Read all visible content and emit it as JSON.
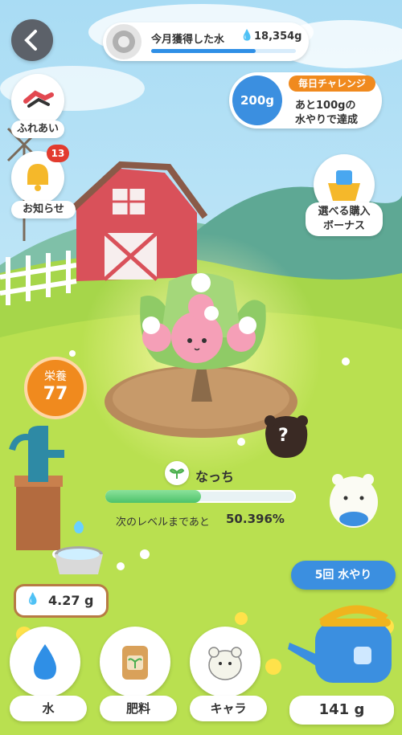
{
  "header": {
    "back_label": "<",
    "monthly_label": "今月獲得した水",
    "monthly_amount": "18,354g",
    "monthly_progress": 0.72
  },
  "challenge": {
    "title": "毎日チャレンジ",
    "target": "200g",
    "message_line1": "あと100gの",
    "message_line2": "水やりで達成"
  },
  "side_menu": {
    "fureai": "ふれあい",
    "notice": "お知らせ",
    "notice_badge": "13"
  },
  "bonus": {
    "line1": "選べる購入",
    "line2": "ボーナス"
  },
  "nutrition": {
    "label": "栄養",
    "value": "77"
  },
  "plant": {
    "name": "なっち",
    "level_text": "次のレベルまであと",
    "level_percent": "50.396%",
    "level_progress": 0.504
  },
  "mystery": {
    "mark": "?"
  },
  "water_stock": {
    "amount": "4.27 g"
  },
  "watering": {
    "button": "5回 水やり",
    "amount": "141 g"
  },
  "bottom_nav": {
    "water": "水",
    "fertilizer": "肥料",
    "character": "キャラ"
  },
  "colors": {
    "accent_blue": "#2f8fe6",
    "orange": "#f08a1e",
    "badge_red": "#e23b2e",
    "progress_green": "#5fd07a"
  }
}
